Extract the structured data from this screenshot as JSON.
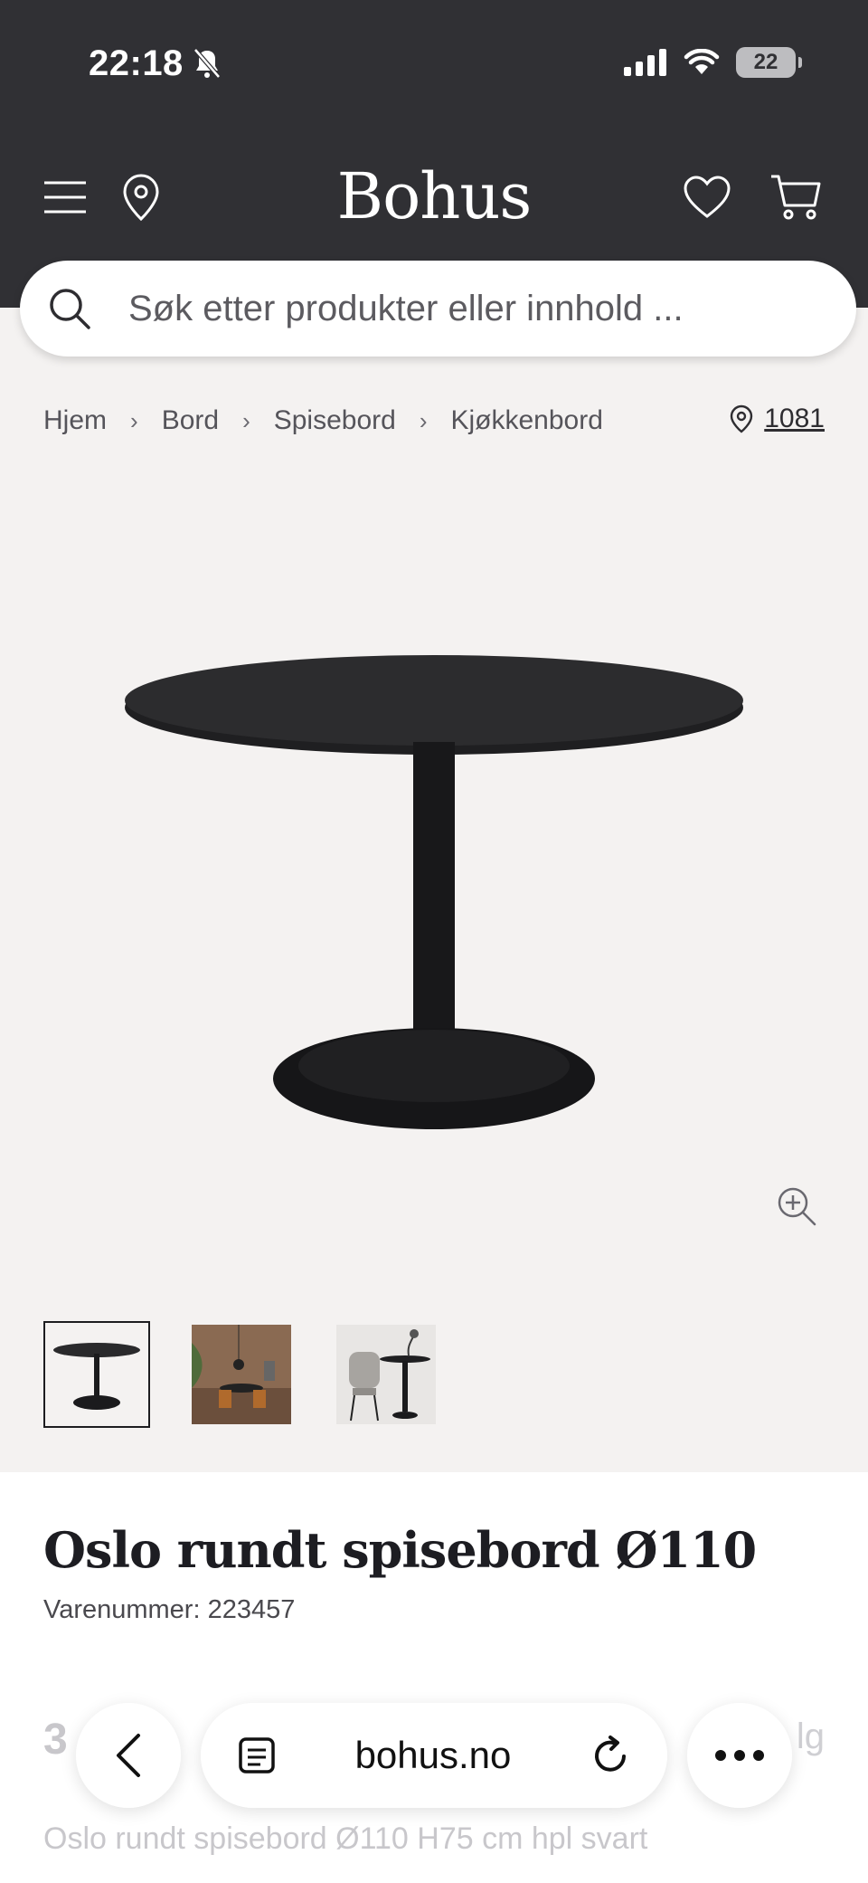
{
  "status": {
    "time": "22:18",
    "battery": "22"
  },
  "header": {
    "logo": "Bohus"
  },
  "search": {
    "placeholder": "Søk etter produkter eller innhold ..."
  },
  "breadcrumb": [
    "Hjem",
    "Bord",
    "Spisebord",
    "Kjøkkenbord"
  ],
  "store": {
    "label": "1081"
  },
  "product": {
    "title": "Oslo rundt spisebord Ø110",
    "sku": "Varenummer: 223457",
    "price_partial": "3",
    "right_partial": "lg",
    "description": "Oslo rundt spisebord Ø110 H75 cm hpl svart"
  },
  "browser": {
    "url": "bohus.no"
  },
  "colors": {
    "header_bg": "#303034",
    "page_bg": "#f4f2f1",
    "text_dark": "#1d1d22"
  }
}
